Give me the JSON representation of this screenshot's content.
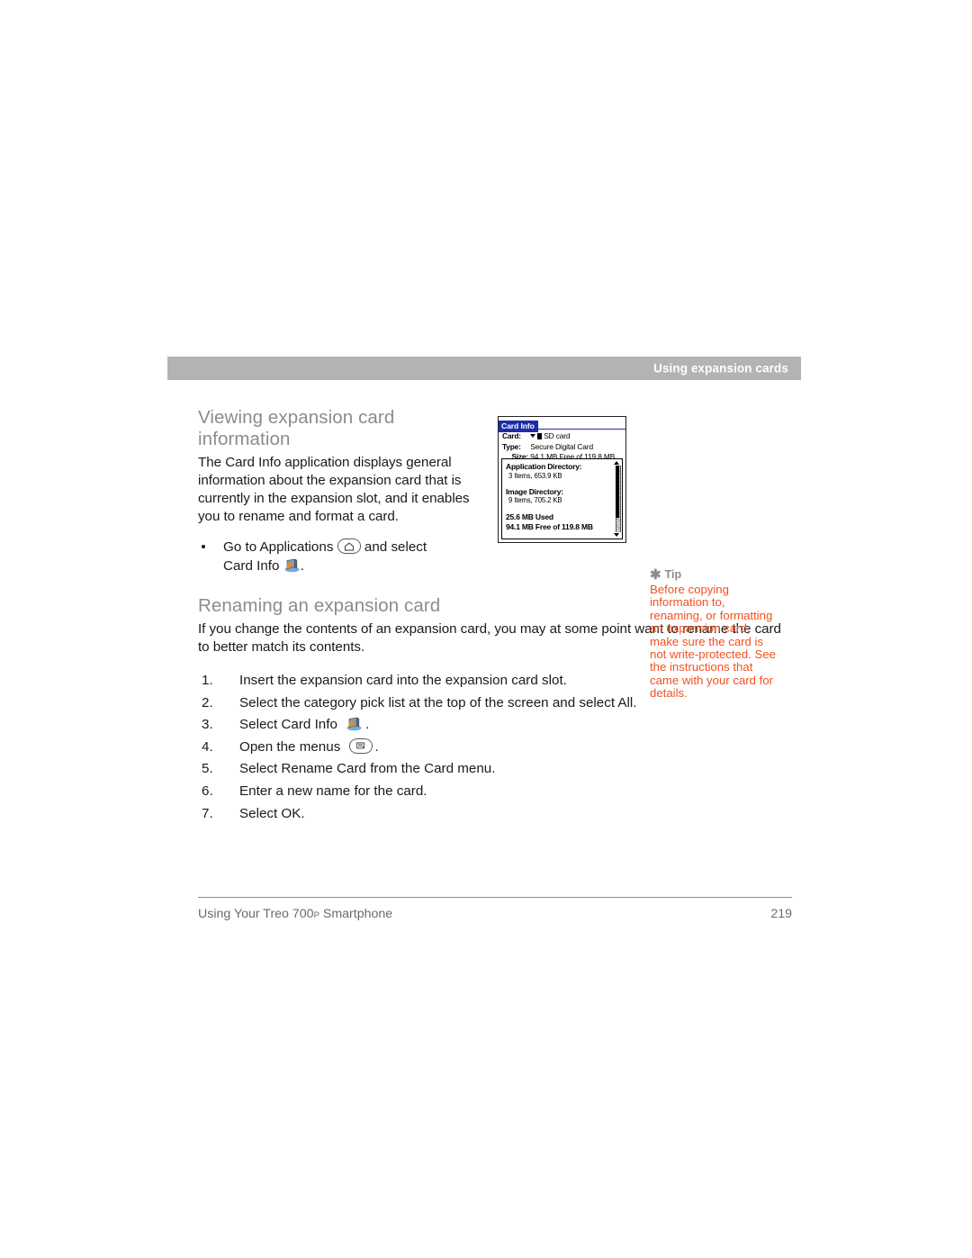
{
  "header": {
    "running_title": "Using expansion cards"
  },
  "sections": [
    {
      "heading": "Viewing expansion card information",
      "paragraph": "The Card Info application displays general information about the expansion card that is currently in the expansion slot, and it enables you to rename and format a card.",
      "bullets": [
        {
          "text_before": "Go to Applications",
          "icon1": "applications-home-icon",
          "text_middle": "and select",
          "text_line2": "Card Info",
          "icon2": "card-info-icon",
          "text_after": "."
        }
      ]
    },
    {
      "heading": "Renaming an expansion card",
      "paragraph": "If you change the contents of an expansion card, you may at some point want to rename the card to better match its contents.",
      "steps": [
        {
          "num": "1.",
          "text": "Insert the expansion card into the expansion card slot."
        },
        {
          "num": "2.",
          "text": "Select the category pick list at the top of the screen and select All."
        },
        {
          "num": "3.",
          "text": "Select Card Info",
          "icon": "card-info-icon",
          "text_after": "."
        },
        {
          "num": "4.",
          "text": "Open the menus",
          "icon": "menu-button-icon",
          "text_after": "."
        },
        {
          "num": "5.",
          "text": "Select Rename Card from the Card menu."
        },
        {
          "num": "6.",
          "text": "Enter a new name for the card."
        },
        {
          "num": "7.",
          "text": "Select OK."
        }
      ]
    }
  ],
  "device_screenshot": {
    "app_title": "Card Info",
    "fields": [
      {
        "label": "Card:",
        "value": "SD card",
        "has_picklist": true
      },
      {
        "label": "Type:",
        "value": "Secure Digital Card",
        "has_picklist": false
      },
      {
        "label": "Size:",
        "value": "94.1 MB Free of 119.8 MB",
        "has_picklist": false
      }
    ],
    "directories": [
      {
        "name": "Application Directory:",
        "details": "3 Items, 653.9 KB"
      },
      {
        "name": "Image Directory:",
        "details": "9 Items, 705.2 KB"
      }
    ],
    "summary": [
      "25.6 MB Used",
      "94.1 MB Free of 119.8 MB"
    ]
  },
  "tip": {
    "label": "Tip",
    "icon": "asterisk-icon",
    "body": "Before copying information to, renaming, or formatting an expansion card, make sure the card is not write-protected. See the instructions that came with your card for details."
  },
  "footer": {
    "book_title_part1": "Using Your Treo 700",
    "book_title_sub": "P",
    "book_title_part2": " Smartphone",
    "page_number": "219"
  },
  "colors": {
    "header_bar": "#b3b3b3",
    "heading_gray": "#8c8c8c",
    "tip_orange": "#f4511e",
    "device_title_blue": "#1b2ea8",
    "footer_gray": "#6b6b6b"
  }
}
